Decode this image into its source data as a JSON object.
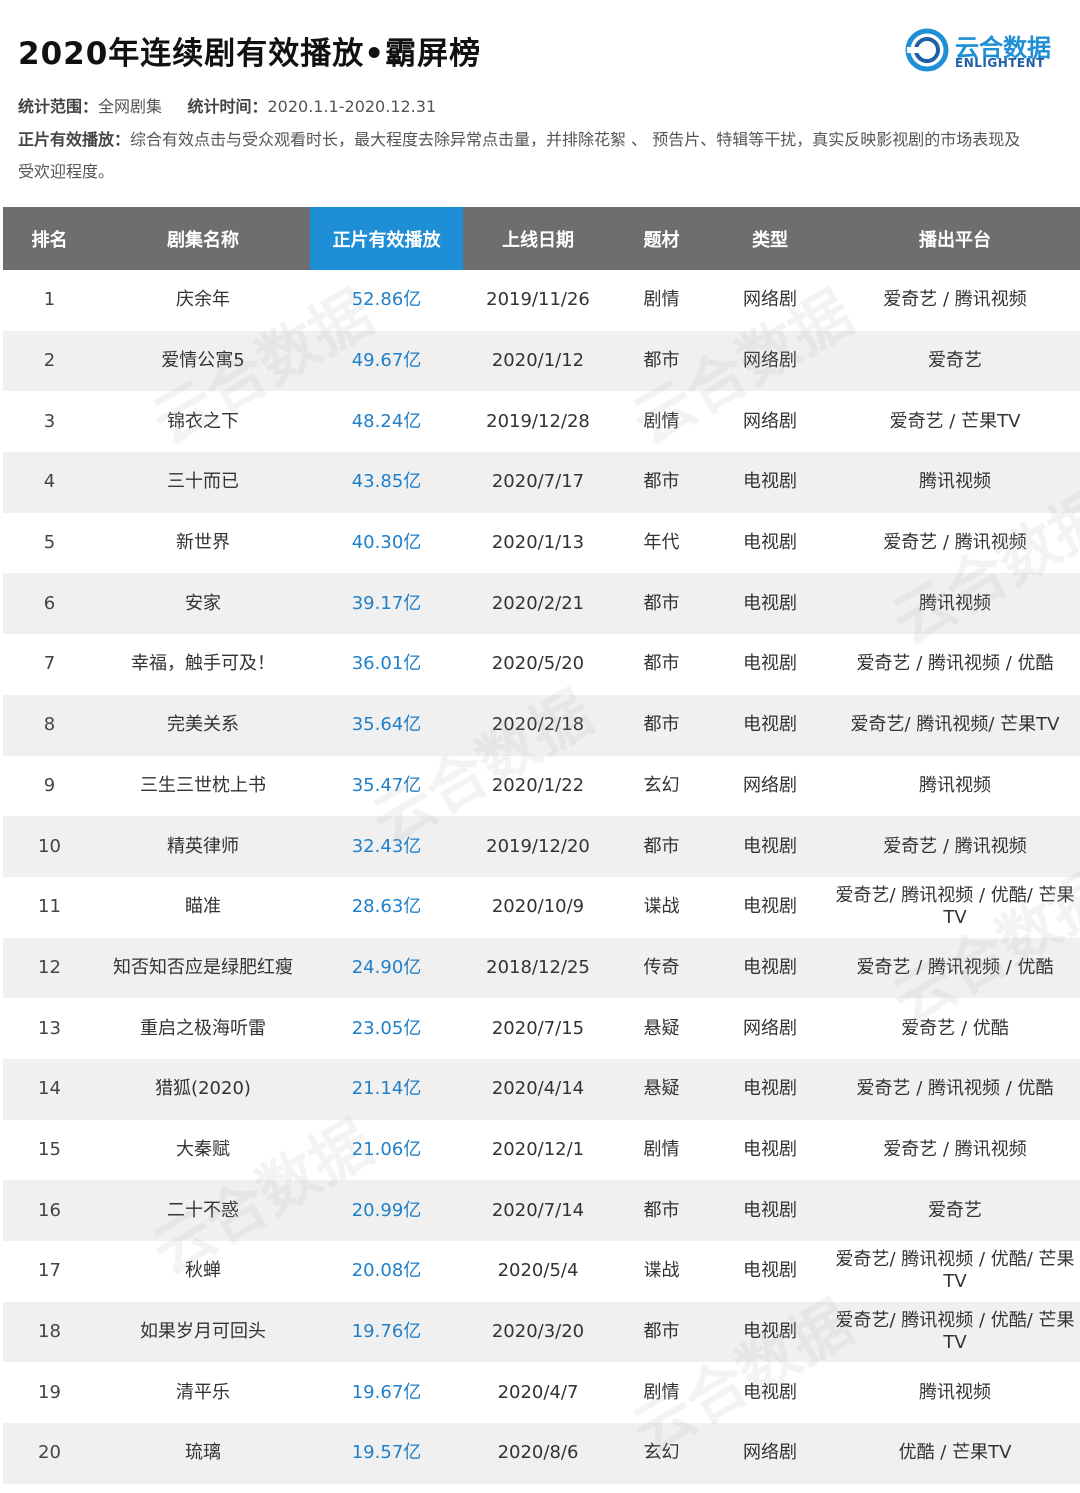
{
  "header": {
    "title": "2020年连续剧有效播放•霸屏榜",
    "logo_cn": "云合数据",
    "logo_en": "ENLIGHTENT"
  },
  "meta": {
    "scope_label": "统计范围：",
    "scope_value": "全网剧集",
    "time_label": "统计时间：",
    "time_value": "2020.1.1-2020.12.31",
    "def_label": "正片有效播放：",
    "def_value": "综合有效点击与受众观看时长，最大程度去除异常点击量，并排除花絮 、 预告片、特辑等干扰，真实反映影视剧的市场表现及受欢迎程度。"
  },
  "table": {
    "headers": [
      "排名",
      "剧集名称",
      "正片有效播放",
      "上线日期",
      "题材",
      "类型",
      "播出平台"
    ],
    "rows": [
      [
        "1",
        "庆余年",
        "52.86亿",
        "2019/11/26",
        "剧情",
        "网络剧",
        "爱奇艺 / 腾讯视频"
      ],
      [
        "2",
        "爱情公寓5",
        "49.67亿",
        "2020/1/12",
        "都市",
        "网络剧",
        "爱奇艺"
      ],
      [
        "3",
        "锦衣之下",
        "48.24亿",
        "2019/12/28",
        "剧情",
        "网络剧",
        "爱奇艺 / 芒果TV"
      ],
      [
        "4",
        "三十而已",
        "43.85亿",
        "2020/7/17",
        "都市",
        "电视剧",
        "腾讯视频"
      ],
      [
        "5",
        "新世界",
        "40.30亿",
        "2020/1/13",
        "年代",
        "电视剧",
        "爱奇艺 / 腾讯视频"
      ],
      [
        "6",
        "安家",
        "39.17亿",
        "2020/2/21",
        "都市",
        "电视剧",
        "腾讯视频"
      ],
      [
        "7",
        "幸福，触手可及！",
        "36.01亿",
        "2020/5/20",
        "都市",
        "电视剧",
        "爱奇艺 / 腾讯视频 / 优酷"
      ],
      [
        "8",
        "完美关系",
        "35.64亿",
        "2020/2/18",
        "都市",
        "电视剧",
        "爱奇艺/ 腾讯视频/ 芒果TV"
      ],
      [
        "9",
        "三生三世枕上书",
        "35.47亿",
        "2020/1/22",
        "玄幻",
        "网络剧",
        "腾讯视频"
      ],
      [
        "10",
        "精英律师",
        "32.43亿",
        "2019/12/20",
        "都市",
        "电视剧",
        "爱奇艺 / 腾讯视频"
      ],
      [
        "11",
        "瞄准",
        "28.63亿",
        "2020/10/9",
        "谍战",
        "电视剧",
        "爱奇艺/ 腾讯视频 / 优酷/ 芒果TV"
      ],
      [
        "12",
        "知否知否应是绿肥红瘦",
        "24.90亿",
        "2018/12/25",
        "传奇",
        "电视剧",
        "爱奇艺 / 腾讯视频 / 优酷"
      ],
      [
        "13",
        "重启之极海听雷",
        "23.05亿",
        "2020/7/15",
        "悬疑",
        "网络剧",
        "爱奇艺 / 优酷"
      ],
      [
        "14",
        "猎狐(2020)",
        "21.14亿",
        "2020/4/14",
        "悬疑",
        "电视剧",
        "爱奇艺 / 腾讯视频 / 优酷"
      ],
      [
        "15",
        "大秦赋",
        "21.06亿",
        "2020/12/1",
        "剧情",
        "电视剧",
        "爱奇艺 / 腾讯视频"
      ],
      [
        "16",
        "二十不惑",
        "20.99亿",
        "2020/7/14",
        "都市",
        "电视剧",
        "爱奇艺"
      ],
      [
        "17",
        "秋蝉",
        "20.08亿",
        "2020/5/4",
        "谍战",
        "电视剧",
        "爱奇艺/ 腾讯视频 / 优酷/ 芒果TV"
      ],
      [
        "18",
        "如果岁月可回头",
        "19.76亿",
        "2020/3/20",
        "都市",
        "电视剧",
        "爱奇艺/ 腾讯视频 / 优酷/ 芒果TV"
      ],
      [
        "19",
        "清平乐",
        "19.67亿",
        "2020/4/7",
        "剧情",
        "电视剧",
        "腾讯视频"
      ],
      [
        "20",
        "琉璃",
        "19.57亿",
        "2020/8/6",
        "玄幻",
        "网络剧",
        "优酷 / 芒果TV"
      ]
    ]
  },
  "colors": {
    "header_bg": "#6e6e6e",
    "header_highlight": "#1e8ed6",
    "plays_text": "#1f7fc8",
    "row_alt": "#f0f0f0"
  }
}
